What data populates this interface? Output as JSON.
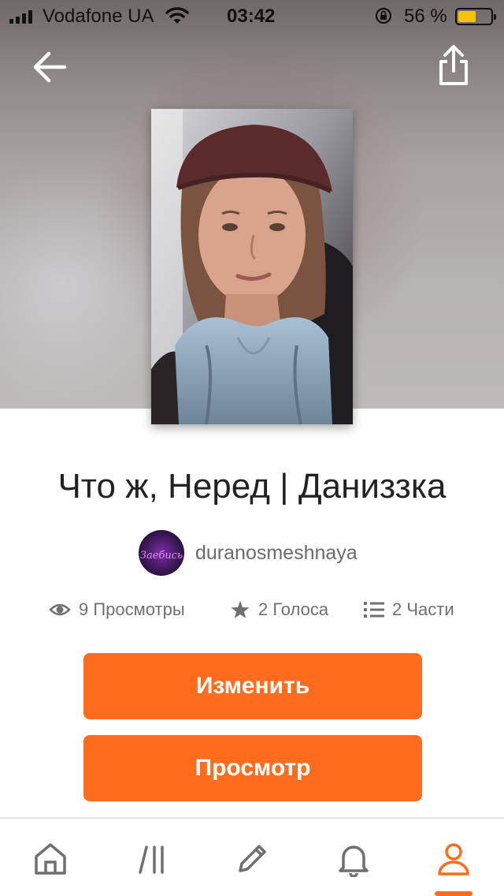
{
  "status_bar": {
    "carrier": "Vodafone UA",
    "time": "03:42",
    "battery": "56 %",
    "battery_level": 0.56
  },
  "story": {
    "title": "Что ж, Неред | Даниззка",
    "author": "duranosmeshnaya",
    "avatar_text": "Заебись",
    "stats": {
      "views": "9 Просмотры",
      "votes": "2 Голоса",
      "parts": "2 Части"
    }
  },
  "actions": {
    "edit_label": "Изменить",
    "view_label": "Просмотр"
  },
  "bottom_nav": {
    "items": [
      "home-icon",
      "library-icon",
      "write-icon",
      "notifications-icon",
      "profile-icon"
    ],
    "active": "profile-icon"
  },
  "colors": {
    "accent": "#ff6c1e",
    "battery": "#f5c400"
  }
}
